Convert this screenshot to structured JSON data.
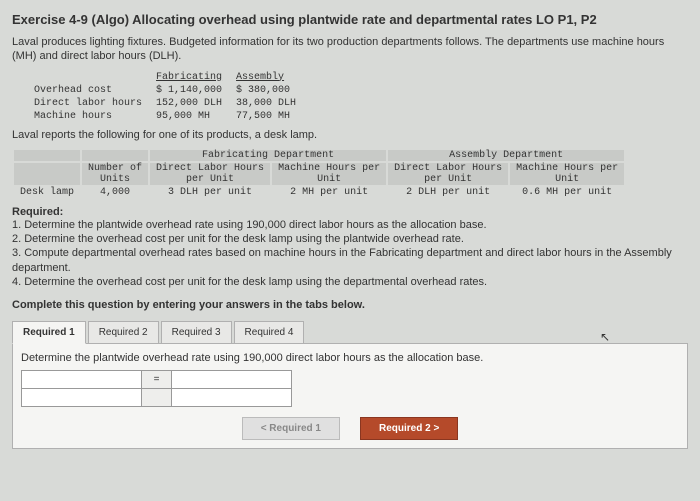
{
  "title": "Exercise 4-9 (Algo) Allocating overhead using plantwide rate and departmental rates LO P1, P2",
  "intro": "Laval produces lighting fixtures. Budgeted information for its two production departments follows. The departments use machine hours (MH) and direct labor hours (DLH).",
  "dept": {
    "headers": {
      "c1": "",
      "c2": "Fabricating",
      "c3": "Assembly"
    },
    "rows": [
      {
        "label": "Overhead cost",
        "fab": "$ 1,140,000",
        "asm": "$ 380,000"
      },
      {
        "label": "Direct labor hours",
        "fab": "152,000 DLH",
        "asm": "38,000 DLH"
      },
      {
        "label": "Machine hours",
        "fab": "95,000 MH",
        "asm": "77,500 MH"
      }
    ]
  },
  "desc2": "Laval reports the following for one of its products, a desk lamp.",
  "prod": {
    "group1": "Fabricating Department",
    "group2": "Assembly Department",
    "h_units": "Number of\nUnits",
    "h_fdlh": "Direct Labor Hours\nper Unit",
    "h_fmh": "Machine Hours per\nUnit",
    "h_adlh": "Direct Labor Hours\nper Unit",
    "h_amh": "Machine Hours per\nUnit",
    "row": {
      "label": "Desk lamp",
      "units": "4,000",
      "fdlh": "3 DLH per unit",
      "fmh": "2 MH per unit",
      "adlh": "2 DLH per unit",
      "amh": "0.6 MH per unit"
    }
  },
  "req": {
    "title": "Required:",
    "r1": "1. Determine the plantwide overhead rate using 190,000 direct labor hours as the allocation base.",
    "r2": "2. Determine the overhead cost per unit for the desk lamp using the plantwide overhead rate.",
    "r3": "3. Compute departmental overhead rates based on machine hours in the Fabricating department and direct labor hours in the Assembly department.",
    "r4": "4. Determine the overhead cost per unit for the desk lamp using the departmental overhead rates."
  },
  "complete": "Complete this question by entering your answers in the tabs below.",
  "tabs": {
    "t1": "Required 1",
    "t2": "Required 2",
    "t3": "Required 3",
    "t4": "Required 4"
  },
  "panel_prompt": "Determine the plantwide overhead rate using 190,000 direct labor hours as the allocation base.",
  "eq": "=",
  "nav": {
    "prev": "<  Required 1",
    "next": "Required 2  >"
  }
}
